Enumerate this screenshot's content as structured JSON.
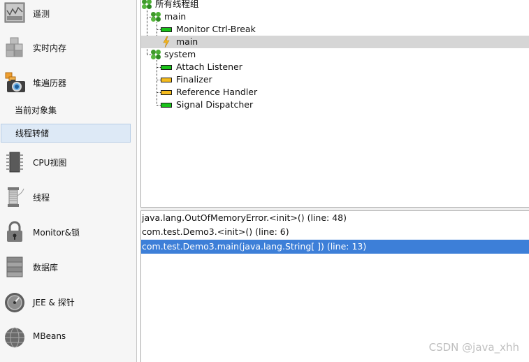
{
  "sidebar": {
    "items": [
      {
        "label": "遥测",
        "icon": "telemetry-icon"
      },
      {
        "label": "实时内存",
        "icon": "live-memory-icon"
      },
      {
        "label": "堆遍历器",
        "icon": "heap-walker-icon"
      },
      {
        "label": "CPU视图",
        "icon": "cpu-icon"
      },
      {
        "label": "线程",
        "icon": "threads-icon"
      },
      {
        "label": "Monitor&锁",
        "icon": "lock-icon"
      },
      {
        "label": "数据库",
        "icon": "database-icon"
      },
      {
        "label": "JEE & 探针",
        "icon": "gauge-icon"
      },
      {
        "label": "MBeans",
        "icon": "globe-icon"
      }
    ],
    "sub_items": [
      {
        "label": "当前对象集",
        "selected": false
      },
      {
        "label": "线程转储",
        "selected": true
      }
    ]
  },
  "tree": {
    "root": "所有线程组",
    "groups": [
      {
        "name": "main",
        "threads": [
          {
            "name": "Monitor Ctrl-Break",
            "state": "green"
          },
          {
            "name": "main",
            "state": "running",
            "selected": true
          }
        ]
      },
      {
        "name": "system",
        "threads": [
          {
            "name": "Attach Listener",
            "state": "green"
          },
          {
            "name": "Finalizer",
            "state": "yellow"
          },
          {
            "name": "Reference Handler",
            "state": "yellow"
          },
          {
            "name": "Signal Dispatcher",
            "state": "green"
          }
        ]
      }
    ]
  },
  "stack": [
    {
      "text": "java.lang.OutOfMemoryError.<init>() (line: 48)",
      "selected": false
    },
    {
      "text": "com.test.Demo3.<init>() (line: 6)",
      "selected": false
    },
    {
      "text": "com.test.Demo3.main(java.lang.String[ ]) (line: 13)",
      "selected": true
    }
  ],
  "watermark": "CSDN @java_xhh",
  "colors": {
    "selection": "#3d7fd8",
    "tree_selection": "#d6d6d6",
    "green": "#19c219",
    "yellow": "#f4bb1e"
  }
}
